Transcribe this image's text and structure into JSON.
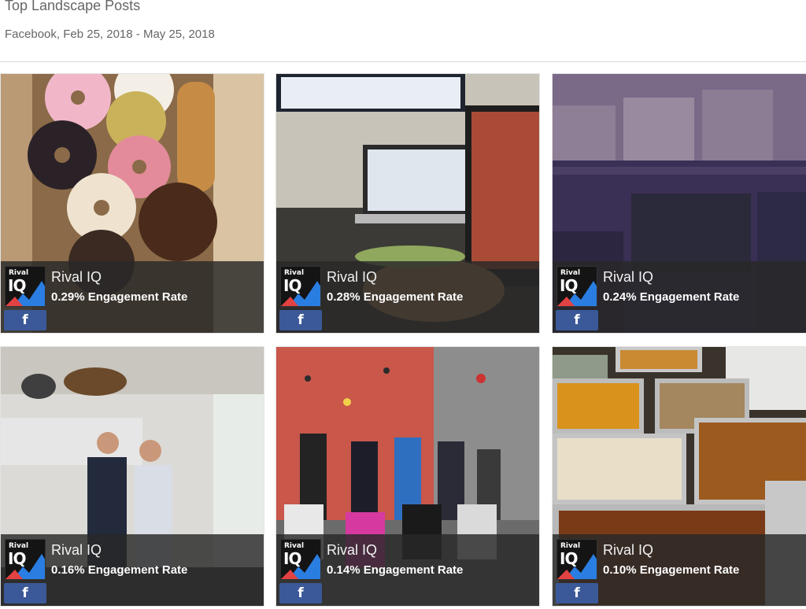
{
  "header": {
    "title": "Top Landscape Posts",
    "subtitle": "Facebook, Feb 25, 2018 - May 25, 2018"
  },
  "posts": [
    {
      "account": "Rival IQ",
      "engagement": "0.29% Engagement Rate",
      "platform_icon": "f",
      "image": "donuts"
    },
    {
      "account": "Rival IQ",
      "engagement": "0.28% Engagement Rate",
      "platform_icon": "f",
      "image": "office-laptops"
    },
    {
      "account": "Rival IQ",
      "engagement": "0.24% Engagement Rate",
      "platform_icon": "f",
      "image": "circuit-board"
    },
    {
      "account": "Rival IQ",
      "engagement": "0.16% Engagement Rate",
      "platform_icon": "f",
      "image": "hubspot-office"
    },
    {
      "account": "Rival IQ",
      "engagement": "0.14% Engagement Rate",
      "platform_icon": "f",
      "image": "climbing-gym-group"
    },
    {
      "account": "Rival IQ",
      "engagement": "0.10% Engagement Rate",
      "platform_icon": "f",
      "image": "food-trays"
    }
  ],
  "logo": {
    "line1": "Rival",
    "line2": "IQ"
  },
  "colors": {
    "facebook": "#3b5998",
    "overlay": "#282828",
    "logo_accent": "#2a7de1"
  }
}
